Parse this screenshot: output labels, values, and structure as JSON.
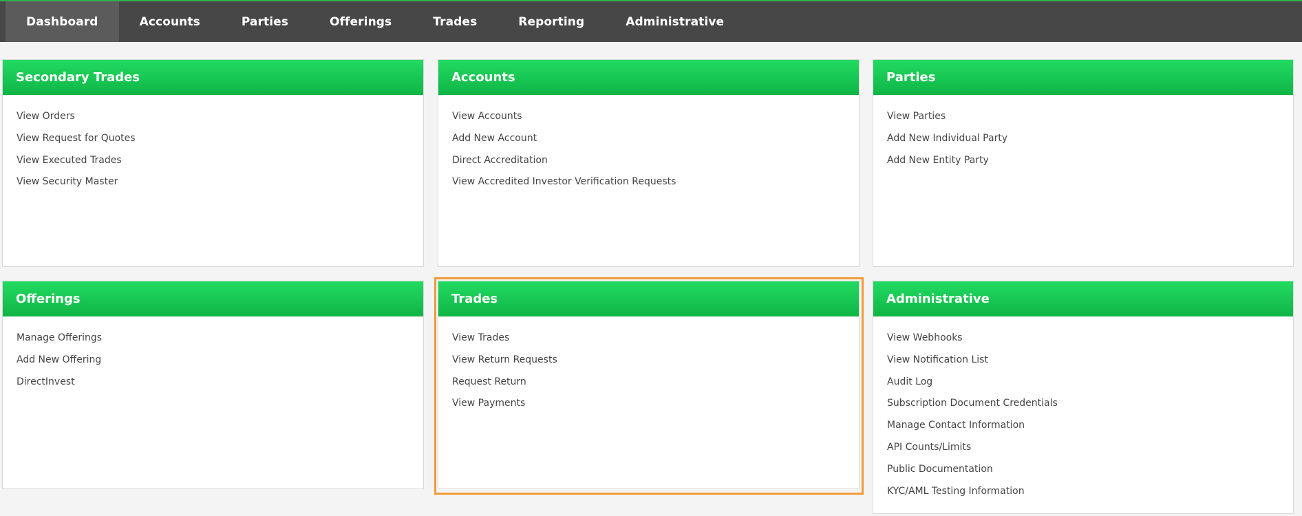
{
  "nav": {
    "items": [
      "Dashboard",
      "Accounts",
      "Parties",
      "Offerings",
      "Trades",
      "Reporting",
      "Administrative"
    ],
    "active": "Dashboard"
  },
  "panels": [
    {
      "title": "Secondary Trades",
      "links": [
        "View Orders",
        "View Request for Quotes",
        "View Executed Trades",
        "View Security Master"
      ]
    },
    {
      "title": "Accounts",
      "links": [
        "View Accounts",
        "Add New Account",
        "Direct Accreditation",
        "View Accredited Investor Verification Requests"
      ]
    },
    {
      "title": "Parties",
      "links": [
        "View Parties",
        "Add New Individual Party",
        "Add New Entity Party"
      ]
    },
    {
      "title": "Offerings",
      "links": [
        "Manage Offerings",
        "Add New Offering",
        "DirectInvest"
      ]
    },
    {
      "title": "Trades",
      "links": [
        "View Trades",
        "View Return Requests",
        "Request Return",
        "View Payments"
      ]
    },
    {
      "title": "Administrative",
      "links": [
        "View Webhooks",
        "View Notification List",
        "Audit Log",
        "Subscription Document Credentials",
        "Manage Contact Information",
        "API Counts/Limits",
        "Public Documentation",
        "KYC/AML Testing Information"
      ]
    }
  ],
  "colors": {
    "nav_bg": "#474747",
    "nav_active_bg": "#5b5b5b",
    "header_green_top": "#22da61",
    "header_green_bottom": "#0fb546",
    "highlight_orange": "#f29a3a"
  }
}
